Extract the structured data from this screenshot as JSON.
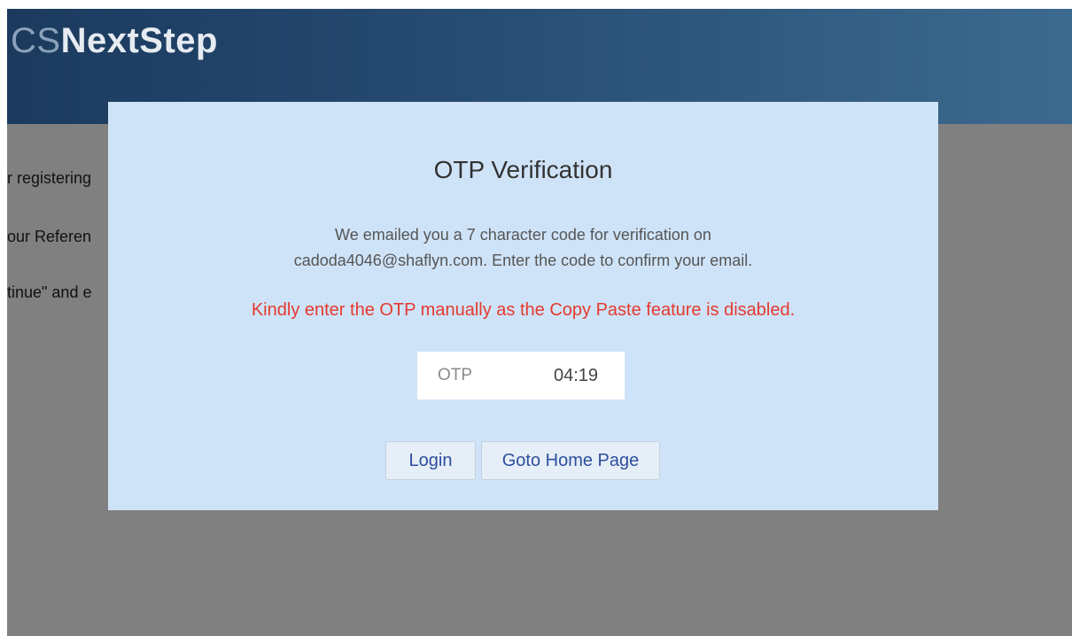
{
  "header": {
    "brand_prefix": "CS",
    "brand_main": "NextStep"
  },
  "background": {
    "lines": [
      "r registering",
      "our Referen",
      "tinue\" and e"
    ]
  },
  "modal": {
    "title": "OTP Verification",
    "description_line1": "We emailed you a 7 character code for verification on",
    "description_line2": "cadoda4046@shaflyn.com. Enter the code to confirm your email.",
    "warning": "Kindly enter the OTP manually as the Copy Paste feature is disabled.",
    "otp": {
      "placeholder": "OTP",
      "value": "",
      "timer": "04:19"
    },
    "buttons": {
      "login": "Login",
      "home": "Goto Home Page"
    }
  },
  "colors": {
    "header_start": "#1b3a5e",
    "header_end": "#3c6a8e",
    "overlay": "#808080",
    "modal_bg": "#cfe3f8",
    "warning": "#e53a2f",
    "button_text": "#2d4f9e"
  }
}
